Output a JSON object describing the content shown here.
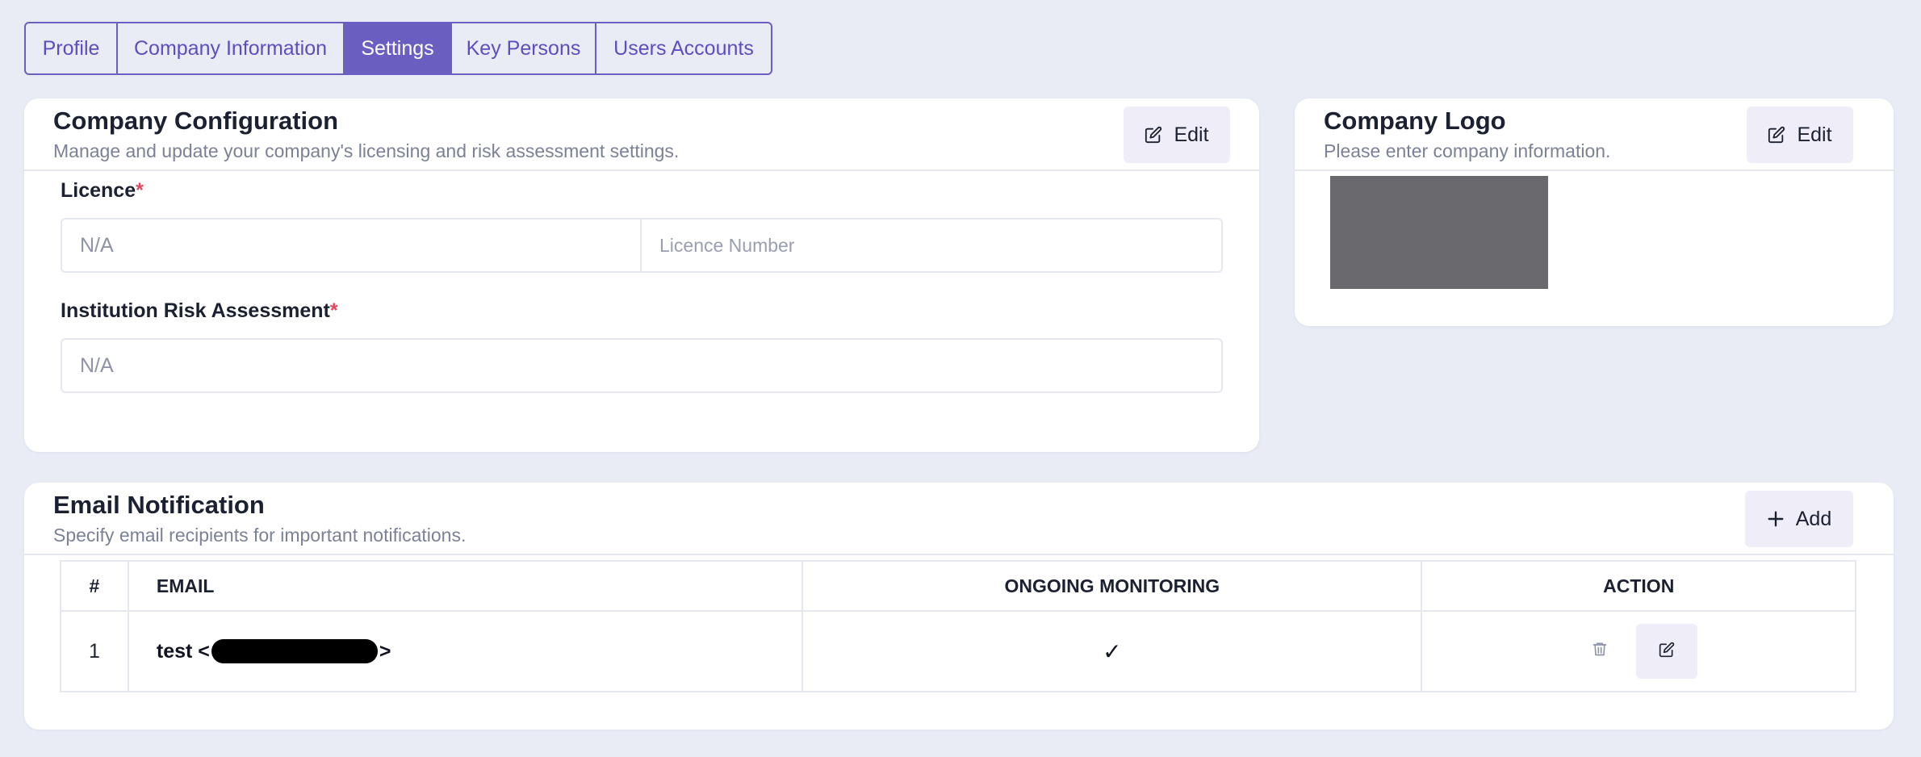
{
  "tabs": [
    {
      "label": "Profile",
      "active": false
    },
    {
      "label": "Company Information",
      "active": false
    },
    {
      "label": "Settings",
      "active": true
    },
    {
      "label": "Key Persons",
      "active": false
    },
    {
      "label": "Users Accounts",
      "active": false
    }
  ],
  "config": {
    "title": "Company Configuration",
    "subtitle": "Manage and update your company's licensing and risk assessment settings.",
    "edit_label": "Edit",
    "licence": {
      "label": "Licence",
      "required_mark": "*",
      "value": "N/A",
      "number_placeholder": "Licence Number"
    },
    "risk": {
      "label": "Institution Risk Assessment",
      "required_mark": "*",
      "value": "N/A"
    }
  },
  "logo": {
    "title": "Company Logo",
    "subtitle": "Please enter company information.",
    "edit_label": "Edit"
  },
  "email": {
    "title": "Email Notification",
    "subtitle": "Specify email recipients for important notifications.",
    "add_label": "Add",
    "columns": [
      "#",
      "EMAIL",
      "ONGOING MONITORING",
      "ACTION"
    ],
    "rows": [
      {
        "num": "1",
        "name_prefix": "test <",
        "name_suffix": ">",
        "monitoring": "✓"
      }
    ]
  },
  "colors": {
    "accent": "#6a5fc1",
    "background": "#e9ebf5",
    "required": "#e0475b",
    "button_bg": "#efeef8"
  },
  "icons": {
    "edit": "edit-icon",
    "add": "plus-icon",
    "delete": "trash-icon"
  }
}
